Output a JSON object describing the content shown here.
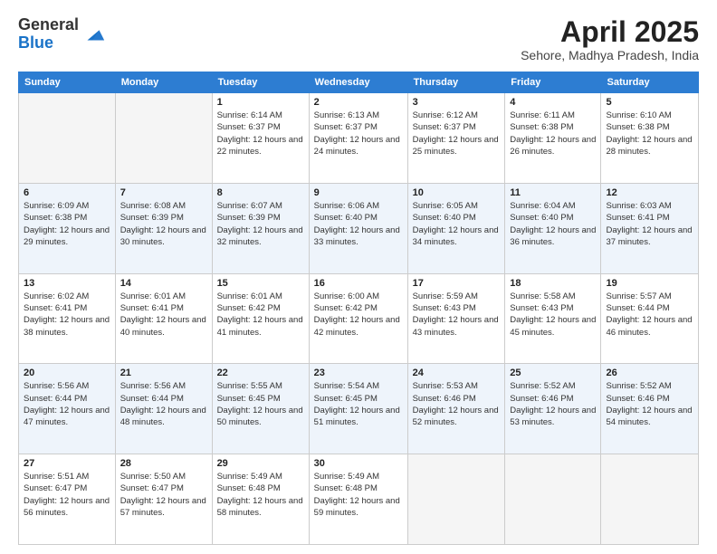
{
  "header": {
    "logo_general": "General",
    "logo_blue": "Blue",
    "month_title": "April 2025",
    "subtitle": "Sehore, Madhya Pradesh, India"
  },
  "days_of_week": [
    "Sunday",
    "Monday",
    "Tuesday",
    "Wednesday",
    "Thursday",
    "Friday",
    "Saturday"
  ],
  "weeks": [
    [
      {
        "day": "",
        "sunrise": "",
        "sunset": "",
        "daylight": ""
      },
      {
        "day": "",
        "sunrise": "",
        "sunset": "",
        "daylight": ""
      },
      {
        "day": "1",
        "sunrise": "Sunrise: 6:14 AM",
        "sunset": "Sunset: 6:37 PM",
        "daylight": "Daylight: 12 hours and 22 minutes."
      },
      {
        "day": "2",
        "sunrise": "Sunrise: 6:13 AM",
        "sunset": "Sunset: 6:37 PM",
        "daylight": "Daylight: 12 hours and 24 minutes."
      },
      {
        "day": "3",
        "sunrise": "Sunrise: 6:12 AM",
        "sunset": "Sunset: 6:37 PM",
        "daylight": "Daylight: 12 hours and 25 minutes."
      },
      {
        "day": "4",
        "sunrise": "Sunrise: 6:11 AM",
        "sunset": "Sunset: 6:38 PM",
        "daylight": "Daylight: 12 hours and 26 minutes."
      },
      {
        "day": "5",
        "sunrise": "Sunrise: 6:10 AM",
        "sunset": "Sunset: 6:38 PM",
        "daylight": "Daylight: 12 hours and 28 minutes."
      }
    ],
    [
      {
        "day": "6",
        "sunrise": "Sunrise: 6:09 AM",
        "sunset": "Sunset: 6:38 PM",
        "daylight": "Daylight: 12 hours and 29 minutes."
      },
      {
        "day": "7",
        "sunrise": "Sunrise: 6:08 AM",
        "sunset": "Sunset: 6:39 PM",
        "daylight": "Daylight: 12 hours and 30 minutes."
      },
      {
        "day": "8",
        "sunrise": "Sunrise: 6:07 AM",
        "sunset": "Sunset: 6:39 PM",
        "daylight": "Daylight: 12 hours and 32 minutes."
      },
      {
        "day": "9",
        "sunrise": "Sunrise: 6:06 AM",
        "sunset": "Sunset: 6:40 PM",
        "daylight": "Daylight: 12 hours and 33 minutes."
      },
      {
        "day": "10",
        "sunrise": "Sunrise: 6:05 AM",
        "sunset": "Sunset: 6:40 PM",
        "daylight": "Daylight: 12 hours and 34 minutes."
      },
      {
        "day": "11",
        "sunrise": "Sunrise: 6:04 AM",
        "sunset": "Sunset: 6:40 PM",
        "daylight": "Daylight: 12 hours and 36 minutes."
      },
      {
        "day": "12",
        "sunrise": "Sunrise: 6:03 AM",
        "sunset": "Sunset: 6:41 PM",
        "daylight": "Daylight: 12 hours and 37 minutes."
      }
    ],
    [
      {
        "day": "13",
        "sunrise": "Sunrise: 6:02 AM",
        "sunset": "Sunset: 6:41 PM",
        "daylight": "Daylight: 12 hours and 38 minutes."
      },
      {
        "day": "14",
        "sunrise": "Sunrise: 6:01 AM",
        "sunset": "Sunset: 6:41 PM",
        "daylight": "Daylight: 12 hours and 40 minutes."
      },
      {
        "day": "15",
        "sunrise": "Sunrise: 6:01 AM",
        "sunset": "Sunset: 6:42 PM",
        "daylight": "Daylight: 12 hours and 41 minutes."
      },
      {
        "day": "16",
        "sunrise": "Sunrise: 6:00 AM",
        "sunset": "Sunset: 6:42 PM",
        "daylight": "Daylight: 12 hours and 42 minutes."
      },
      {
        "day": "17",
        "sunrise": "Sunrise: 5:59 AM",
        "sunset": "Sunset: 6:43 PM",
        "daylight": "Daylight: 12 hours and 43 minutes."
      },
      {
        "day": "18",
        "sunrise": "Sunrise: 5:58 AM",
        "sunset": "Sunset: 6:43 PM",
        "daylight": "Daylight: 12 hours and 45 minutes."
      },
      {
        "day": "19",
        "sunrise": "Sunrise: 5:57 AM",
        "sunset": "Sunset: 6:44 PM",
        "daylight": "Daylight: 12 hours and 46 minutes."
      }
    ],
    [
      {
        "day": "20",
        "sunrise": "Sunrise: 5:56 AM",
        "sunset": "Sunset: 6:44 PM",
        "daylight": "Daylight: 12 hours and 47 minutes."
      },
      {
        "day": "21",
        "sunrise": "Sunrise: 5:56 AM",
        "sunset": "Sunset: 6:44 PM",
        "daylight": "Daylight: 12 hours and 48 minutes."
      },
      {
        "day": "22",
        "sunrise": "Sunrise: 5:55 AM",
        "sunset": "Sunset: 6:45 PM",
        "daylight": "Daylight: 12 hours and 50 minutes."
      },
      {
        "day": "23",
        "sunrise": "Sunrise: 5:54 AM",
        "sunset": "Sunset: 6:45 PM",
        "daylight": "Daylight: 12 hours and 51 minutes."
      },
      {
        "day": "24",
        "sunrise": "Sunrise: 5:53 AM",
        "sunset": "Sunset: 6:46 PM",
        "daylight": "Daylight: 12 hours and 52 minutes."
      },
      {
        "day": "25",
        "sunrise": "Sunrise: 5:52 AM",
        "sunset": "Sunset: 6:46 PM",
        "daylight": "Daylight: 12 hours and 53 minutes."
      },
      {
        "day": "26",
        "sunrise": "Sunrise: 5:52 AM",
        "sunset": "Sunset: 6:46 PM",
        "daylight": "Daylight: 12 hours and 54 minutes."
      }
    ],
    [
      {
        "day": "27",
        "sunrise": "Sunrise: 5:51 AM",
        "sunset": "Sunset: 6:47 PM",
        "daylight": "Daylight: 12 hours and 56 minutes."
      },
      {
        "day": "28",
        "sunrise": "Sunrise: 5:50 AM",
        "sunset": "Sunset: 6:47 PM",
        "daylight": "Daylight: 12 hours and 57 minutes."
      },
      {
        "day": "29",
        "sunrise": "Sunrise: 5:49 AM",
        "sunset": "Sunset: 6:48 PM",
        "daylight": "Daylight: 12 hours and 58 minutes."
      },
      {
        "day": "30",
        "sunrise": "Sunrise: 5:49 AM",
        "sunset": "Sunset: 6:48 PM",
        "daylight": "Daylight: 12 hours and 59 minutes."
      },
      {
        "day": "",
        "sunrise": "",
        "sunset": "",
        "daylight": ""
      },
      {
        "day": "",
        "sunrise": "",
        "sunset": "",
        "daylight": ""
      },
      {
        "day": "",
        "sunrise": "",
        "sunset": "",
        "daylight": ""
      }
    ]
  ]
}
